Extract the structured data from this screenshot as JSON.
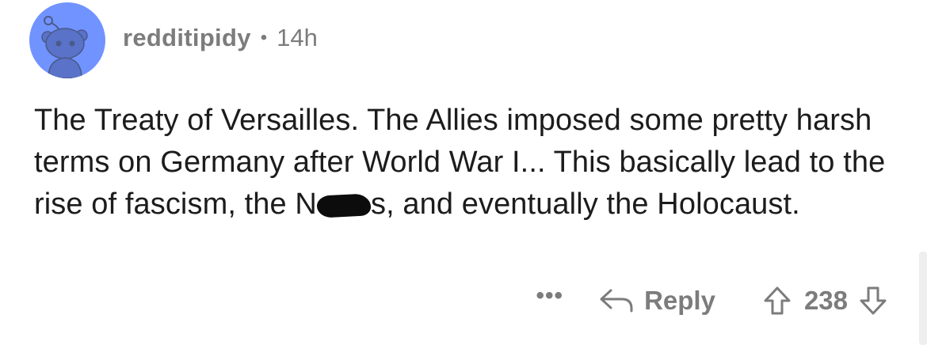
{
  "comment": {
    "avatar_icon": "reddit-snoo-avatar-icon",
    "avatar_color": "#7193ff",
    "username": "redditipidy",
    "separator": "•",
    "time_ago": "14h",
    "body_before_censor": "The Treaty of Versailles.  The Allies imposed some pretty harsh terms on Germany after World War I... This basically lead to the rise of fascism, the N",
    "body_after_censor": "s, and eventually the Holocaust.",
    "censored_note": "redacted-scribble",
    "more_label": "•••",
    "reply_label": "Reply",
    "vote_count": "238"
  }
}
